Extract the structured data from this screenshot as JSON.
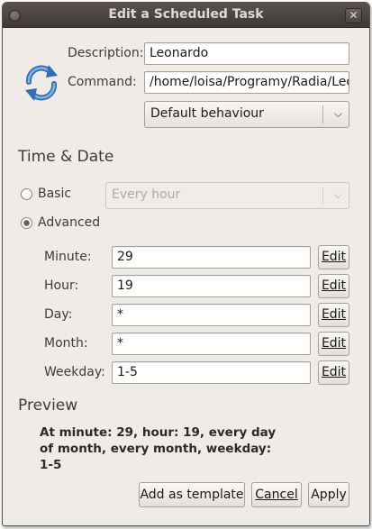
{
  "window": {
    "title": "Edit a Scheduled Task",
    "close_glyph": "✕"
  },
  "form": {
    "description_label": "Description:",
    "description_value": "Leonardo",
    "command_label": "Command:",
    "command_value": "/home/loisa/Programy/Radia/Leona",
    "behaviour_value": "Default behaviour"
  },
  "time_date": {
    "heading": "Time & Date",
    "basic_label": "Basic",
    "basic_value": "Every hour",
    "advanced_label": "Advanced",
    "selected": "advanced",
    "fields": [
      {
        "label": "Minute:",
        "value": "29",
        "edit": "Edit"
      },
      {
        "label": "Hour:",
        "value": "19",
        "edit": "Edit"
      },
      {
        "label": "Day:",
        "value": "*",
        "edit": "Edit"
      },
      {
        "label": "Month:",
        "value": "*",
        "edit": "Edit"
      },
      {
        "label": "Weekday:",
        "value": "1-5",
        "edit": "Edit"
      }
    ]
  },
  "preview": {
    "heading": "Preview",
    "lines": [
      "At minute: 29, hour: 19, every day",
      "of month, every month, weekday:",
      "1-5"
    ]
  },
  "buttons": {
    "add_template": "Add as template",
    "cancel": "Cancel",
    "apply": "Apply"
  },
  "icons": {
    "task": "refresh-icon",
    "combo": "chevron-down-icon",
    "window_menu": "window-menu-icon",
    "close": "close-icon"
  }
}
